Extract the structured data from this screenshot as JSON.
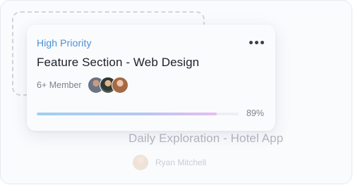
{
  "cards": {
    "active": {
      "priority": "High Priority",
      "title": "Feature Section - Web Design",
      "member_count": "6+ Member",
      "progress": 0.89,
      "progress_label": "89%",
      "more_icon": "more-horizontal-icon",
      "accent": "#4a8fd6"
    },
    "background": {
      "title": "Daily Exploration - Hotel App",
      "owner": "Ryan Mitchell"
    }
  }
}
